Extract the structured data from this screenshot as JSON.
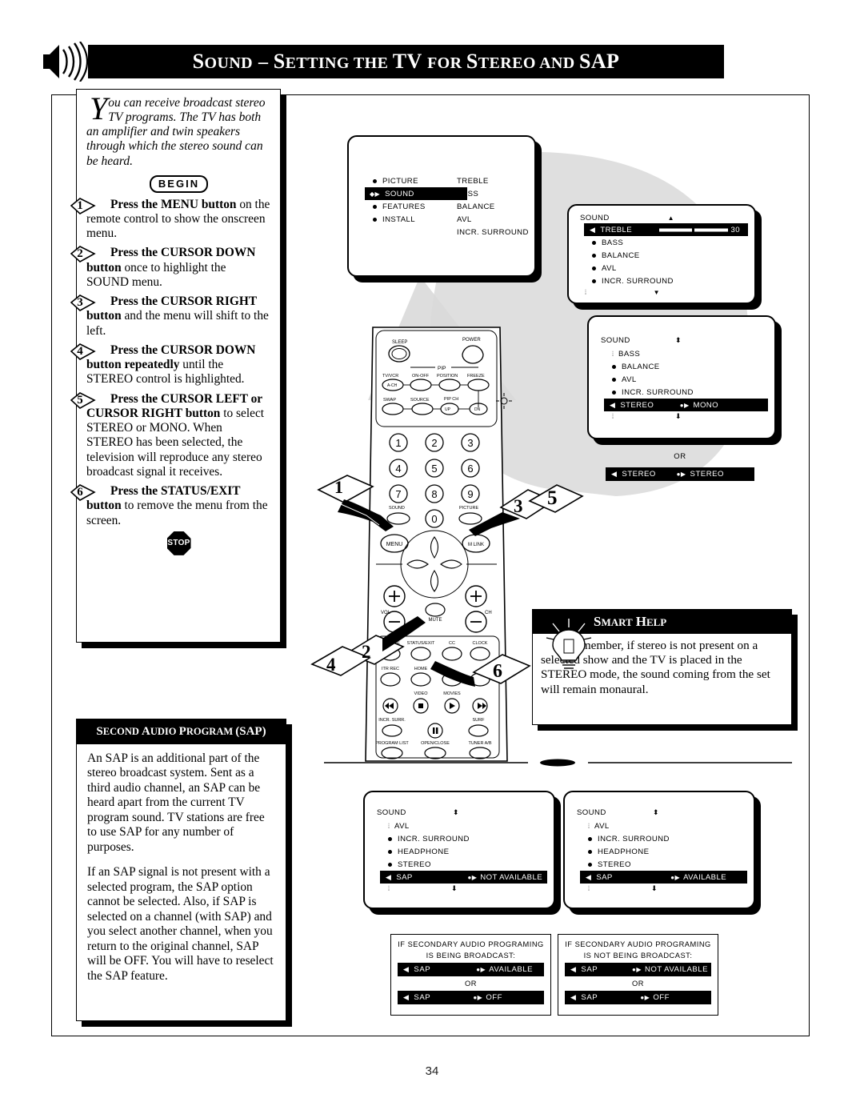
{
  "page": {
    "number": "34",
    "header_title": "Sound – Setting the TV for Stereo and SAP",
    "speaker_icon": "speaker-waves-icon"
  },
  "intro": {
    "dropcap": "Y",
    "text": "ou can receive broadcast stereo TV programs.  The TV has both an amplifier and twin speakers through which the stereo sound can be heard.",
    "begin_label": "BEGIN",
    "stop_label": "STOP"
  },
  "steps": [
    {
      "number": "1",
      "bold": "Press the MENU button",
      "rest": " on the remote control to show the onscreen menu."
    },
    {
      "number": "2",
      "bold": "Press the CURSOR DOWN button",
      "rest": " once to highlight the SOUND menu."
    },
    {
      "number": "3",
      "bold": "Press the CURSOR RIGHT button",
      "rest": " and the menu will shift to the left."
    },
    {
      "number": "4",
      "bold": "Press the CURSOR DOWN button repeatedly",
      "rest": " until the STEREO control is highlighted."
    },
    {
      "number": "5",
      "bold": "Press the CURSOR LEFT or CURSOR RIGHT button",
      "rest": " to select STEREO or MONO.  When STEREO has been selected, the television will reproduce any stereo broadcast signal it receives."
    },
    {
      "number": "6",
      "bold": "Press the STATUS/EXIT button",
      "rest": " to remove the menu from the screen."
    }
  ],
  "sap_panel": {
    "title": "Second Audio Program (SAP)",
    "paragraphs": [
      "An SAP is an additional part of the stereo broadcast system.  Sent as a third audio channel, an SAP can be heard apart from the current TV program sound.  TV stations are free to use SAP for any number of purposes.",
      "If an SAP signal is not present with a selected program, the SAP option cannot be selected.  Also, if SAP is selected on a channel (with SAP) and you select another channel, when you return to the original channel, SAP will be OFF.  You will have to reselect the SAP feature."
    ]
  },
  "osd_main_menu": {
    "left_items": [
      {
        "label": "PICTURE",
        "highlighted": false
      },
      {
        "label": "SOUND",
        "highlighted": true
      },
      {
        "label": "FEATURES",
        "highlighted": false
      },
      {
        "label": "INSTALL",
        "highlighted": false
      }
    ],
    "right_items": [
      "TREBLE",
      "BASS",
      "BALANCE",
      "AVL",
      "INCR. SURROUND"
    ]
  },
  "osd_sound_treble": {
    "title": "SOUND",
    "up_arrow": "▲",
    "down_arrow": "▼",
    "items": [
      {
        "label": "TREBLE",
        "highlighted": true,
        "value": "30",
        "has_slider": true
      },
      {
        "label": "BASS",
        "highlighted": false
      },
      {
        "label": "BALANCE",
        "highlighted": false
      },
      {
        "label": "AVL",
        "highlighted": false
      },
      {
        "label": "INCR. SURROUND",
        "highlighted": false
      }
    ]
  },
  "osd_sound_stereo": {
    "title": "SOUND",
    "items": [
      {
        "label": "BASS",
        "highlighted": false
      },
      {
        "label": "BALANCE",
        "highlighted": false
      },
      {
        "label": "AVL",
        "highlighted": false
      },
      {
        "label": "INCR. SURROUND",
        "highlighted": false
      },
      {
        "label": "STEREO",
        "highlighted": true,
        "value": "MONO"
      }
    ]
  },
  "osd_or": {
    "or_label": "OR",
    "label": "STEREO",
    "value": "STEREO"
  },
  "smart_help": {
    "title": "Smart Help",
    "text": "Remember, if stereo is not present on a selected show and the TV is placed in the STEREO mode, the sound coming from the set will remain monaural.",
    "icon": "lightbulb-icon"
  },
  "osd_sap_not_available": {
    "title": "SOUND",
    "items": [
      {
        "label": "AVL",
        "highlighted": false
      },
      {
        "label": "INCR. SURROUND",
        "highlighted": false
      },
      {
        "label": "HEADPHONE",
        "highlighted": false
      },
      {
        "label": "STEREO",
        "highlighted": false
      },
      {
        "label": "SAP",
        "highlighted": true,
        "value": "NOT AVAILABLE"
      }
    ]
  },
  "osd_sap_available": {
    "title": "SOUND",
    "items": [
      {
        "label": "AVL",
        "highlighted": false
      },
      {
        "label": "INCR. SURROUND",
        "highlighted": false
      },
      {
        "label": "HEADPHONE",
        "highlighted": false
      },
      {
        "label": "STEREO",
        "highlighted": false
      },
      {
        "label": "SAP",
        "highlighted": true,
        "value": "AVAILABLE"
      }
    ]
  },
  "explain_broadcast": {
    "caption_line1": "IF SECONDARY AUDIO PROGRAMING",
    "caption_line2": "IS BEING BROADCAST:",
    "bar1_label": "SAP",
    "bar1_value": "AVAILABLE",
    "or_label": "OR",
    "bar2_label": "SAP",
    "bar2_value": "OFF"
  },
  "explain_not_broadcast": {
    "caption_line1": "IF SECONDARY AUDIO PROGRAMING",
    "caption_line2": "IS NOT BEING BROADCAST:",
    "bar1_label": "SAP",
    "bar1_value": "NOT AVAILABLE",
    "or_label": "OR",
    "bar2_label": "SAP",
    "bar2_value": "OFF"
  },
  "remote": {
    "callouts": [
      "1",
      "2",
      "3",
      "4",
      "5",
      "6"
    ],
    "buttons": {
      "sleep": "SLEEP",
      "power": "POWER",
      "pip": "PIP",
      "tv_vcr": "TV/VCR",
      "a_ch": "A-CH",
      "on_off": "ON-OFF",
      "position": "POSITION",
      "freeze": "FREEZE",
      "swap": "SWAP",
      "source": "SOURCE",
      "pip_ch": "PIP CH",
      "up": "UP",
      "dn": "DN",
      "keys": [
        "1",
        "2",
        "3",
        "4",
        "5",
        "6",
        "7",
        "8",
        "9",
        "0"
      ],
      "sound": "SOUND",
      "picture": "PICTURE",
      "menu": "MENU",
      "m_link": "M LINK",
      "vol": "VOL",
      "ch": "CH",
      "mute": "MUTE",
      "source2": "SOURCE",
      "status_exit": "STATUS/EXIT",
      "cc": "CC",
      "clock": "CLOCK",
      "itr_rec": "ITR REC",
      "home": "HOME",
      "video": "VIDEO",
      "movies": "MOVIES",
      "incr_surr": "INCR. SURR.",
      "surf": "SURF",
      "program_list": "PROGRAM LIST",
      "open_close": "OPEN/CLOSE",
      "tuner_ab": "TUNER A/B"
    }
  }
}
